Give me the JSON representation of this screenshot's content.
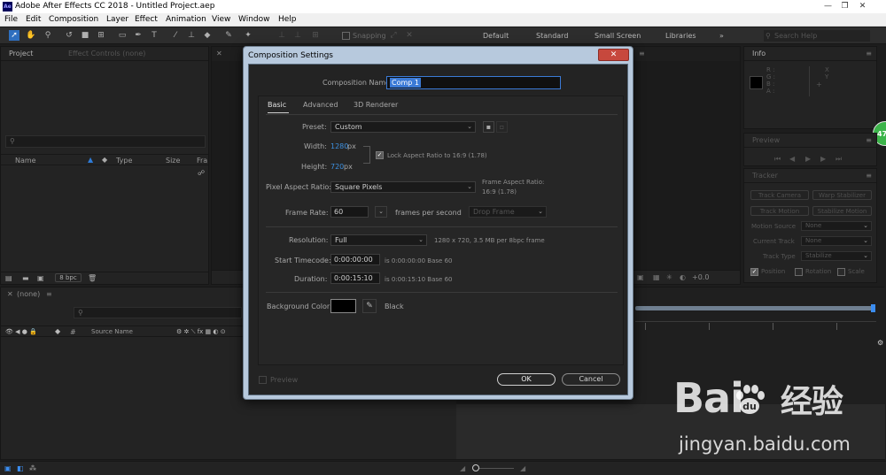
{
  "window": {
    "app_badge": "Ae",
    "title": "Adobe After Effects CC 2018 - Untitled Project.aep",
    "minimize": "—",
    "maximize": "❐",
    "close": "✕"
  },
  "menu": [
    "File",
    "Edit",
    "Composition",
    "Layer",
    "Effect",
    "Animation",
    "View",
    "Window",
    "Help"
  ],
  "toolbar": {
    "snapping_label": "Snapping",
    "workspaces": [
      "Default",
      "Standard",
      "Small Screen",
      "Libraries"
    ],
    "more_workspaces": "»",
    "search_placeholder": "Search Help"
  },
  "project_panel": {
    "tab_project": "Project",
    "tab_effect_controls": "Effect Controls (none)",
    "columns": [
      "Name",
      "Type",
      "Size",
      "Fra"
    ],
    "bpc": "8 bpc"
  },
  "timeline_panel": {
    "tab": "(none)",
    "source_name_col": "Source Name",
    "hash_col": "#"
  },
  "viewer": {
    "offset": "+0.0"
  },
  "info_panel": {
    "title": "Info",
    "channels": [
      "R :",
      "G :",
      "B :",
      "A :"
    ],
    "x_label": "X",
    "y_label": "Y",
    "badge": "47"
  },
  "preview_panel": {
    "title": "Preview"
  },
  "tracker_panel": {
    "title": "Tracker",
    "buttons": [
      "Track Camera",
      "Warp Stabilizer",
      "Track Motion",
      "Stabilize Motion"
    ],
    "motion_source_label": "Motion Source",
    "motion_source_value": "None",
    "current_track_label": "Current Track",
    "current_track_value": "None",
    "track_type_label": "Track Type",
    "track_type_value": "Stabilize",
    "checks": [
      "Position",
      "Rotation",
      "Scale"
    ]
  },
  "dialog": {
    "title": "Composition Settings",
    "close": "✕",
    "comp_name_label": "Composition Name:",
    "comp_name_value": "Comp 1",
    "tabs": [
      "Basic",
      "Advanced",
      "3D Renderer"
    ],
    "preset_label": "Preset:",
    "preset_value": "Custom",
    "width_label": "Width:",
    "width_value": "1280",
    "height_label": "Height:",
    "height_value": "720",
    "px": "px",
    "lock_aspect_label": "Lock Aspect Ratio to 16:9 (1.78)",
    "par_label": "Pixel Aspect Ratio:",
    "par_value": "Square Pixels",
    "frame_aspect_line1": "Frame Aspect Ratio:",
    "frame_aspect_line2": "16:9 (1.78)",
    "frame_rate_label": "Frame Rate:",
    "frame_rate_value": "60",
    "frames_per_second": "frames per second",
    "drop_frame_value": "Drop Frame",
    "resolution_label": "Resolution:",
    "resolution_value": "Full",
    "resolution_info": "1280 x 720, 3.5 MB per 8bpc frame",
    "start_timecode_label": "Start Timecode:",
    "start_timecode_value": "0:00:00:00",
    "start_timecode_info": "is 0:00:00:00  Base 60",
    "duration_label": "Duration:",
    "duration_value": "0:00:15:10",
    "duration_info": "is 0:00:15:10  Base 60",
    "bg_color_label": "Background Color:",
    "bg_color_name": "Black",
    "bg_color_hex": "#000000",
    "preview_label": "Preview",
    "ok": "OK",
    "cancel": "Cancel"
  },
  "watermark": {
    "logo_left": "Bai",
    "logo_right": "经验",
    "url": "jingyan.baidu.com"
  },
  "colors": {
    "accent_blue": "#2e6fbf",
    "value_blue": "#3d90e0",
    "badge_green": "#3cb44a",
    "close_red": "#c7483d"
  }
}
